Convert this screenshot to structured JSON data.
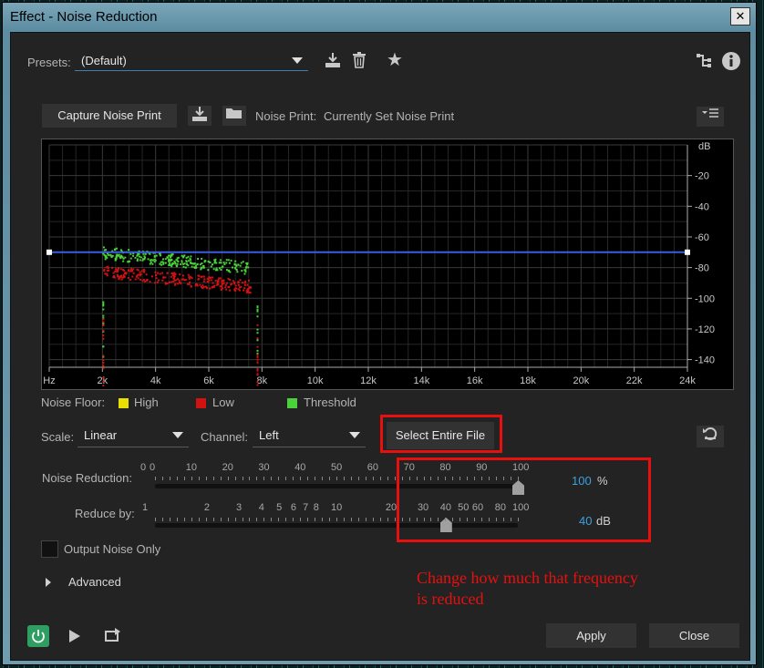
{
  "window": {
    "title": "Effect - Noise Reduction",
    "close_glyph": "✕"
  },
  "presets": {
    "label": "Presets:",
    "value": "(Default)"
  },
  "capture": {
    "button": "Capture Noise Print",
    "noise_print_label": "Noise Print:",
    "noise_print_value": "Currently Set Noise Print"
  },
  "graph": {
    "y_unit": "dB",
    "y_ticks": [
      "-20",
      "-40",
      "-60",
      "-80",
      "-100",
      "-120",
      "-140"
    ],
    "x_ticks": [
      "Hz",
      "2k",
      "4k",
      "6k",
      "8k",
      "10k",
      "12k",
      "14k",
      "16k",
      "18k",
      "20k",
      "22k",
      "24k"
    ],
    "threshold_db": -70
  },
  "chart_data": {
    "type": "scatter",
    "xlabel": "",
    "ylabel": "dB",
    "xlim": [
      0,
      24000
    ],
    "ylim": [
      -145,
      0
    ],
    "series": [
      {
        "name": "Threshold",
        "color": "#4bd13a",
        "band_hz": [
          2000,
          7600
        ],
        "level_db": [
          -70,
          -80
        ]
      },
      {
        "name": "Low",
        "color": "#d01212",
        "band_hz": [
          2000,
          7600
        ],
        "level_db": [
          -82,
          -92
        ]
      }
    ],
    "threshold_line_db": -70
  },
  "legend": {
    "label": "Noise Floor:",
    "items": [
      {
        "name": "High",
        "color": "#e8e000"
      },
      {
        "name": "Low",
        "color": "#d01212"
      },
      {
        "name": "Threshold",
        "color": "#4bd13a"
      }
    ]
  },
  "scale": {
    "label": "Scale:",
    "value": "Linear"
  },
  "channel": {
    "label": "Channel:",
    "value": "Left"
  },
  "select_entire_file": "Select Entire File",
  "noise_reduction": {
    "label": "Noise Reduction:",
    "value": "100",
    "unit": "%",
    "ticks": [
      "0",
      "0",
      "10",
      "20",
      "30",
      "40",
      "50",
      "60",
      "70",
      "80",
      "90",
      "100"
    ]
  },
  "reduce_by": {
    "label": "Reduce by:",
    "value": "40",
    "unit": "dB",
    "ticks": [
      "1",
      "2",
      "3",
      "4",
      "5",
      "6",
      "7",
      "8",
      "10",
      "20",
      "30",
      "40",
      "50",
      "60",
      "80",
      "100"
    ]
  },
  "output_noise_only": "Output Noise Only",
  "advanced": "Advanced",
  "annotation": {
    "line1": "Change how much that frequency",
    "line2": "is reduced",
    "color": "#e8100f"
  },
  "footer": {
    "apply": "Apply",
    "close": "Close"
  },
  "colors": {
    "accent": "#3da1e0",
    "power_on": "#2e9e62",
    "threshold_line": "#3a5ee0"
  }
}
